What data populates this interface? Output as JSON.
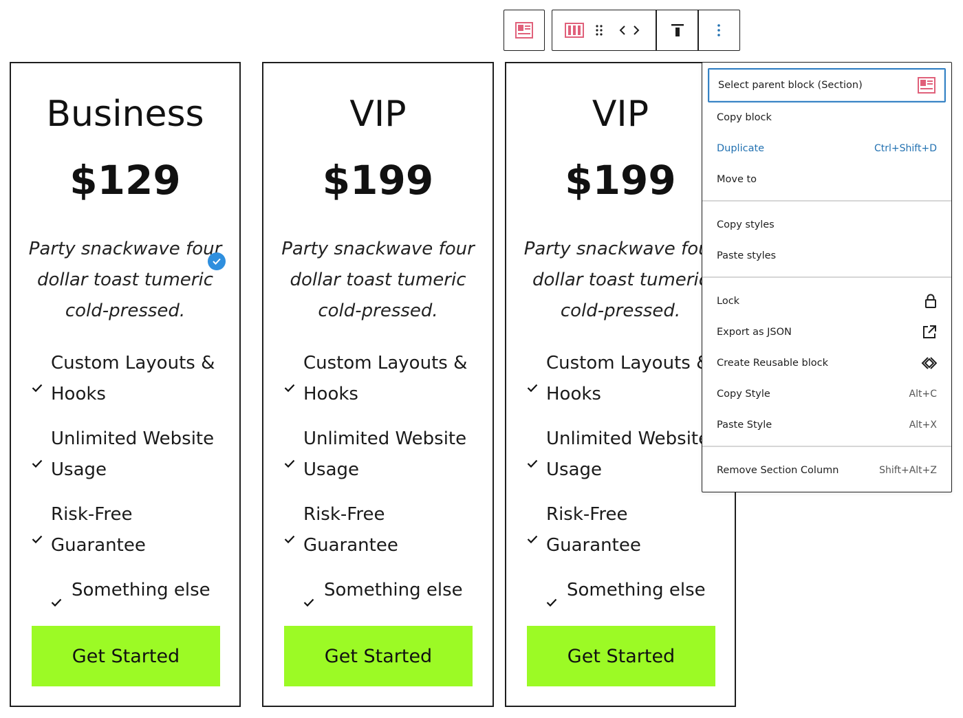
{
  "cards": [
    {
      "title": "Business",
      "price": "$129",
      "description": "Party snackwave four dollar toast tumeric cold-pressed.",
      "features": [
        "Custom Layouts & Hooks",
        "Unlimited Website Usage",
        "Risk-Free Guarantee",
        "Something else"
      ],
      "cta": "Get Started",
      "selected": true
    },
    {
      "title": "VIP",
      "price": "$199",
      "description": "Party snackwave four dollar toast tumeric cold-pressed.",
      "features": [
        "Custom Layouts & Hooks",
        "Unlimited Website Usage",
        "Risk-Free Guarantee",
        "Something else"
      ],
      "cta": "Get Started",
      "selected": false
    },
    {
      "title": "VIP",
      "price": "$199",
      "description": "Party snackwave four dollar toast tumeric cold-pressed.",
      "features": [
        "Custom Layouts & Hooks",
        "Unlimited Website Usage",
        "Risk-Free Guarantee",
        "Something else"
      ],
      "cta": "Get Started",
      "selected": false
    }
  ],
  "toolbar": {
    "icons": [
      "section-block-icon",
      "columns-block-icon",
      "drag-handle-icon",
      "move-arrows-icon",
      "align-top-icon",
      "more-options-icon"
    ]
  },
  "menu": {
    "group1": [
      {
        "label": "Select parent block (Section)",
        "shortcut": "",
        "icon": "section-block-icon"
      },
      {
        "label": "Copy block",
        "shortcut": ""
      },
      {
        "label": "Duplicate",
        "shortcut": "Ctrl+Shift+D"
      },
      {
        "label": "Move to",
        "shortcut": ""
      }
    ],
    "group2": [
      {
        "label": "Copy styles",
        "shortcut": ""
      },
      {
        "label": "Paste styles",
        "shortcut": ""
      }
    ],
    "group3": [
      {
        "label": "Lock",
        "shortcut": "",
        "icon": "lock-icon"
      },
      {
        "label": "Export as JSON",
        "shortcut": "",
        "icon": "external-link-icon"
      },
      {
        "label": "Create Reusable block",
        "shortcut": "",
        "icon": "reusable-block-icon"
      },
      {
        "label": "Copy Style",
        "shortcut": "Alt+C"
      },
      {
        "label": "Paste Style",
        "shortcut": "Alt+X"
      }
    ],
    "group4": [
      {
        "label": "Remove Section Column",
        "shortcut": "Shift+Alt+Z"
      }
    ]
  },
  "colors": {
    "cta_background": "#9cfa25",
    "menu_accent": "#2271b1",
    "selection_badge": "#2f8fde",
    "block_icon": "#e0607a"
  }
}
